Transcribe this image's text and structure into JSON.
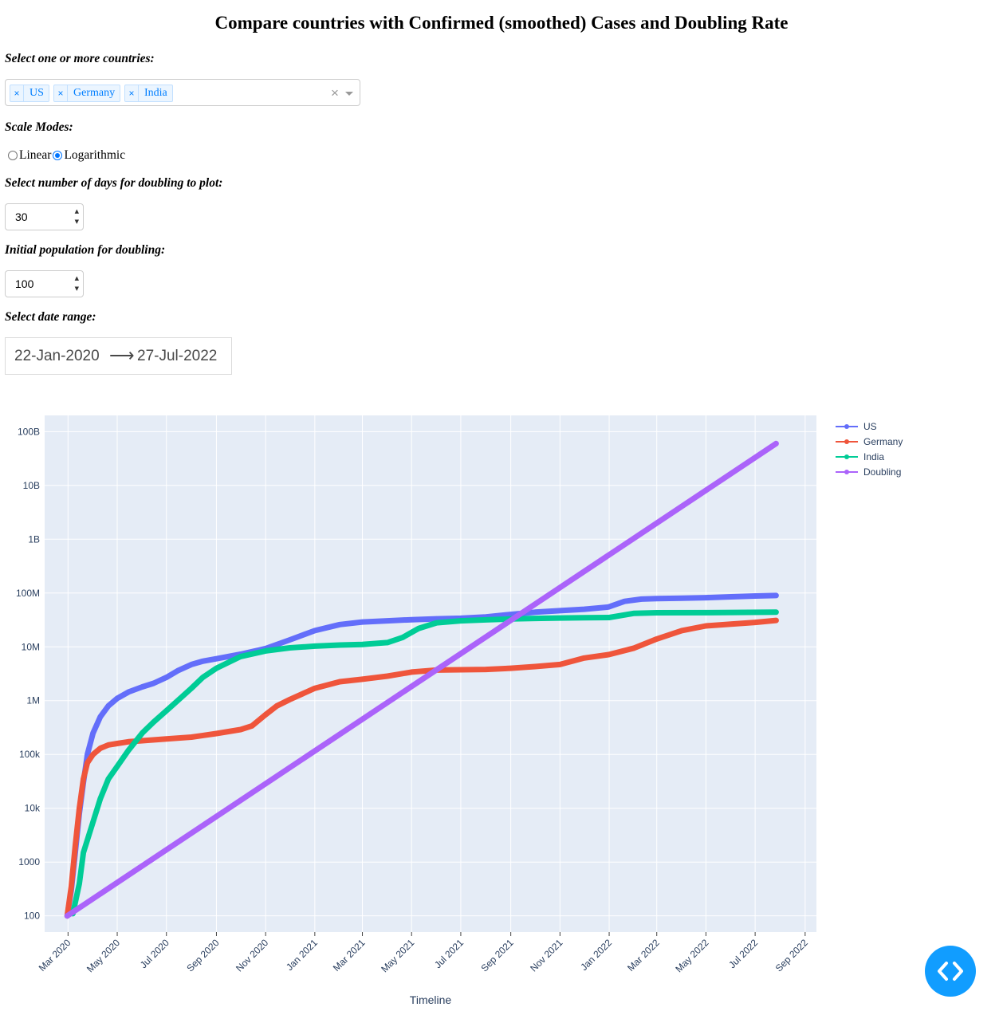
{
  "header": {
    "title": "Compare countries with Confirmed (smoothed) Cases and Doubling Rate"
  },
  "countries": {
    "label": "Select one or more countries:",
    "selected": [
      "US",
      "Germany",
      "India"
    ],
    "remove_glyph": "×",
    "clear_glyph": "×",
    "arrow_icon": "caret-down-icon"
  },
  "scale": {
    "label": "Scale Modes:",
    "options": [
      "Linear",
      "Logarithmic"
    ],
    "selected": "Logarithmic"
  },
  "doubling_days": {
    "label": "Select number of days for doubling to plot:",
    "value": "30"
  },
  "initial_population": {
    "label": "Initial population for doubling:",
    "value": "100"
  },
  "date_range": {
    "label": "Select date range:",
    "start": "22-Jan-2020",
    "arrow": "⟶",
    "end": "27-Jul-2022"
  },
  "colors": {
    "US": "#636efa",
    "Germany": "#ef553b",
    "India": "#00cc96",
    "Doubling": "#ab63fa",
    "plot_bg": "#e5ecf6",
    "fab": "#119dff"
  },
  "chart_data": {
    "type": "scatter",
    "xlabel": "Timeline",
    "ylabel": "",
    "yscale": "log",
    "ylim": [
      50,
      200000000000
    ],
    "xlim": [
      "2020-02-01",
      "2022-09-15"
    ],
    "x_ticks": [
      "Mar 2020",
      "May 2020",
      "Jul 2020",
      "Sep 2020",
      "Nov 2020",
      "Jan 2021",
      "Mar 2021",
      "May 2021",
      "Jul 2021",
      "Sep 2021",
      "Nov 2021",
      "Jan 2022",
      "Mar 2022",
      "May 2022",
      "Jul 2022",
      "Sep 2022"
    ],
    "x_tick_dates": [
      "2020-03-01",
      "2020-05-01",
      "2020-07-01",
      "2020-09-01",
      "2020-11-01",
      "2021-01-01",
      "2021-03-01",
      "2021-05-01",
      "2021-07-01",
      "2021-09-01",
      "2021-11-01",
      "2022-01-01",
      "2022-03-01",
      "2022-05-01",
      "2022-07-01",
      "2022-09-01"
    ],
    "y_tick_values": [
      100,
      1000,
      10000,
      100000,
      1000000,
      10000000,
      100000000,
      1000000000,
      10000000000,
      100000000000
    ],
    "y_tick_labels": [
      "100",
      "1000",
      "10k",
      "100k",
      "1M",
      "10M",
      "100M",
      "1B",
      "10B",
      "100B"
    ],
    "grid": true,
    "legend_position": "top-right",
    "series": [
      {
        "name": "US",
        "points": [
          [
            "2020-02-29",
            100
          ],
          [
            "2020-03-05",
            300
          ],
          [
            "2020-03-10",
            1500
          ],
          [
            "2020-03-15",
            8000
          ],
          [
            "2020-03-20",
            30000
          ],
          [
            "2020-03-25",
            100000
          ],
          [
            "2020-04-01",
            250000
          ],
          [
            "2020-04-10",
            500000
          ],
          [
            "2020-04-20",
            800000
          ],
          [
            "2020-05-01",
            1100000
          ],
          [
            "2020-05-15",
            1450000
          ],
          [
            "2020-06-01",
            1800000
          ],
          [
            "2020-06-15",
            2100000
          ],
          [
            "2020-07-01",
            2700000
          ],
          [
            "2020-07-15",
            3600000
          ],
          [
            "2020-08-01",
            4700000
          ],
          [
            "2020-08-15",
            5400000
          ],
          [
            "2020-09-01",
            6000000
          ],
          [
            "2020-10-01",
            7300000
          ],
          [
            "2020-11-01",
            9300000
          ],
          [
            "2020-12-01",
            13500000
          ],
          [
            "2021-01-01",
            20000000
          ],
          [
            "2021-02-01",
            26000000
          ],
          [
            "2021-03-01",
            29000000
          ],
          [
            "2021-04-01",
            30500000
          ],
          [
            "2021-05-01",
            32000000
          ],
          [
            "2021-06-01",
            33200000
          ],
          [
            "2021-07-01",
            34000000
          ],
          [
            "2021-08-01",
            36000000
          ],
          [
            "2021-09-01",
            40000000
          ],
          [
            "2021-10-01",
            44000000
          ],
          [
            "2021-11-01",
            47000000
          ],
          [
            "2021-12-01",
            50000000
          ],
          [
            "2021-12-31",
            55000000
          ],
          [
            "2022-01-20",
            70000000
          ],
          [
            "2022-02-10",
            77000000
          ],
          [
            "2022-03-01",
            79000000
          ],
          [
            "2022-04-01",
            80000000
          ],
          [
            "2022-05-01",
            82000000
          ],
          [
            "2022-06-01",
            85000000
          ],
          [
            "2022-07-01",
            88000000
          ],
          [
            "2022-07-27",
            90000000
          ]
        ]
      },
      {
        "name": "Germany",
        "points": [
          [
            "2020-02-29",
            100
          ],
          [
            "2020-03-05",
            350
          ],
          [
            "2020-03-10",
            2000
          ],
          [
            "2020-03-15",
            10000
          ],
          [
            "2020-03-20",
            35000
          ],
          [
            "2020-03-25",
            70000
          ],
          [
            "2020-04-01",
            100000
          ],
          [
            "2020-04-10",
            130000
          ],
          [
            "2020-04-20",
            150000
          ],
          [
            "2020-05-01",
            160000
          ],
          [
            "2020-05-15",
            172000
          ],
          [
            "2020-06-01",
            180000
          ],
          [
            "2020-07-01",
            195000
          ],
          [
            "2020-08-01",
            210000
          ],
          [
            "2020-09-01",
            245000
          ],
          [
            "2020-10-01",
            290000
          ],
          [
            "2020-10-15",
            340000
          ],
          [
            "2020-11-01",
            550000
          ],
          [
            "2020-11-15",
            800000
          ],
          [
            "2020-12-01",
            1050000
          ],
          [
            "2021-01-01",
            1700000
          ],
          [
            "2021-02-01",
            2250000
          ],
          [
            "2021-03-01",
            2500000
          ],
          [
            "2021-04-01",
            2850000
          ],
          [
            "2021-05-01",
            3400000
          ],
          [
            "2021-06-01",
            3700000
          ],
          [
            "2021-07-01",
            3750000
          ],
          [
            "2021-08-01",
            3800000
          ],
          [
            "2021-09-01",
            4000000
          ],
          [
            "2021-10-01",
            4300000
          ],
          [
            "2021-11-01",
            4700000
          ],
          [
            "2021-12-01",
            6200000
          ],
          [
            "2022-01-01",
            7200000
          ],
          [
            "2022-02-01",
            9500000
          ],
          [
            "2022-03-01",
            14000000
          ],
          [
            "2022-04-01",
            20000000
          ],
          [
            "2022-05-01",
            24500000
          ],
          [
            "2022-06-01",
            26500000
          ],
          [
            "2022-07-01",
            28500000
          ],
          [
            "2022-07-27",
            31000000
          ]
        ]
      },
      {
        "name": "India",
        "points": [
          [
            "2020-03-07",
            110
          ],
          [
            "2020-03-15",
            400
          ],
          [
            "2020-03-20",
            1500
          ],
          [
            "2020-03-31",
            5000
          ],
          [
            "2020-04-10",
            15000
          ],
          [
            "2020-04-20",
            35000
          ],
          [
            "2020-05-01",
            60000
          ],
          [
            "2020-05-15",
            120000
          ],
          [
            "2020-06-01",
            250000
          ],
          [
            "2020-06-15",
            400000
          ],
          [
            "2020-07-01",
            650000
          ],
          [
            "2020-07-15",
            1000000
          ],
          [
            "2020-08-01",
            1700000
          ],
          [
            "2020-08-15",
            2700000
          ],
          [
            "2020-09-01",
            4000000
          ],
          [
            "2020-10-01",
            6600000
          ],
          [
            "2020-11-01",
            8400000
          ],
          [
            "2020-12-01",
            9600000
          ],
          [
            "2021-01-01",
            10300000
          ],
          [
            "2021-02-01",
            10800000
          ],
          [
            "2021-03-01",
            11100000
          ],
          [
            "2021-04-01",
            12000000
          ],
          [
            "2021-04-20",
            15000000
          ],
          [
            "2021-05-10",
            22000000
          ],
          [
            "2021-06-01",
            28000000
          ],
          [
            "2021-07-01",
            30500000
          ],
          [
            "2021-08-01",
            31800000
          ],
          [
            "2021-09-01",
            33000000
          ],
          [
            "2021-10-01",
            33800000
          ],
          [
            "2021-11-01",
            34300000
          ],
          [
            "2021-12-01",
            34700000
          ],
          [
            "2022-01-01",
            35000000
          ],
          [
            "2022-02-01",
            42000000
          ],
          [
            "2022-03-01",
            43000000
          ],
          [
            "2022-05-01",
            43100000
          ],
          [
            "2022-07-27",
            44000000
          ]
        ]
      },
      {
        "name": "Doubling",
        "points": [
          [
            "2020-02-29",
            100
          ],
          [
            "2022-07-27",
            60000000000
          ]
        ]
      }
    ]
  }
}
